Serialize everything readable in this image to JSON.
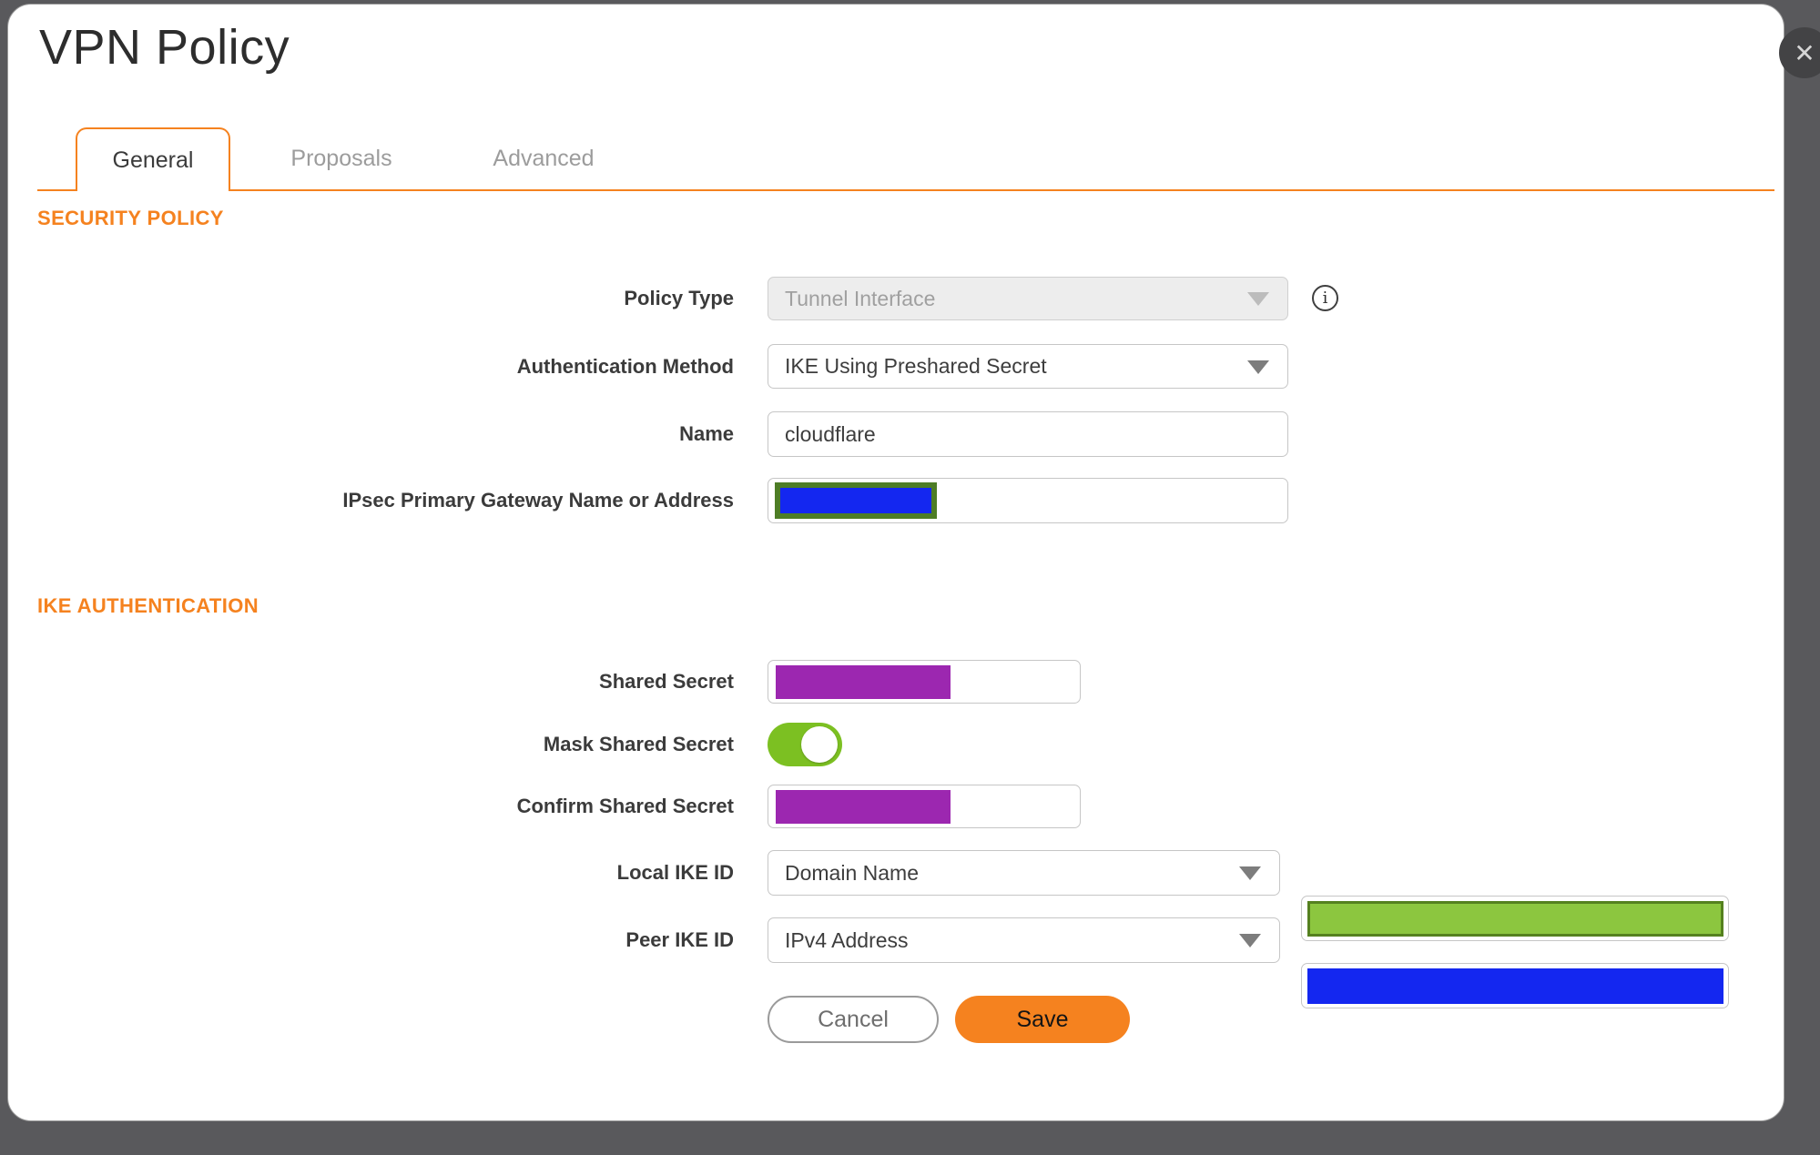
{
  "dialog": {
    "title": "VPN Policy"
  },
  "close": {
    "icon": "✕"
  },
  "tabs": {
    "general": "General",
    "proposals": "Proposals",
    "advanced": "Advanced",
    "active": "General"
  },
  "sections": {
    "security_policy": "SECURITY POLICY",
    "ike_authentication": "IKE AUTHENTICATION"
  },
  "fields": {
    "policy_type": {
      "label": "Policy Type",
      "value": "Tunnel Interface",
      "disabled": "true"
    },
    "auth_method": {
      "label": "Authentication Method",
      "value": "IKE Using Preshared Secret"
    },
    "name": {
      "label": "Name",
      "value": "cloudflare"
    },
    "gateway": {
      "label": "IPsec Primary Gateway Name or Address",
      "value": ""
    },
    "shared_secret": {
      "label": "Shared Secret",
      "masked": "true"
    },
    "mask_shared_secret": {
      "label": "Mask Shared Secret",
      "state": "on"
    },
    "confirm_shared_secret": {
      "label": "Confirm Shared Secret",
      "masked": "true"
    },
    "local_ike_id": {
      "label": "Local IKE ID",
      "value": "Domain Name"
    },
    "peer_ike_id": {
      "label": "Peer IKE ID",
      "value": "IPv4 Address"
    }
  },
  "icons": {
    "info": "i"
  },
  "buttons": {
    "cancel": "Cancel",
    "save": "Save"
  },
  "colors": {
    "accent": "#F5821F",
    "redaction_blue": "#1427F0",
    "redaction_purple": "#9C27B0",
    "redaction_green": "#8CC63F",
    "redaction_green_border": "#55811F",
    "gateway_border": "#4E7D26",
    "toggle_green": "#7CC022"
  }
}
